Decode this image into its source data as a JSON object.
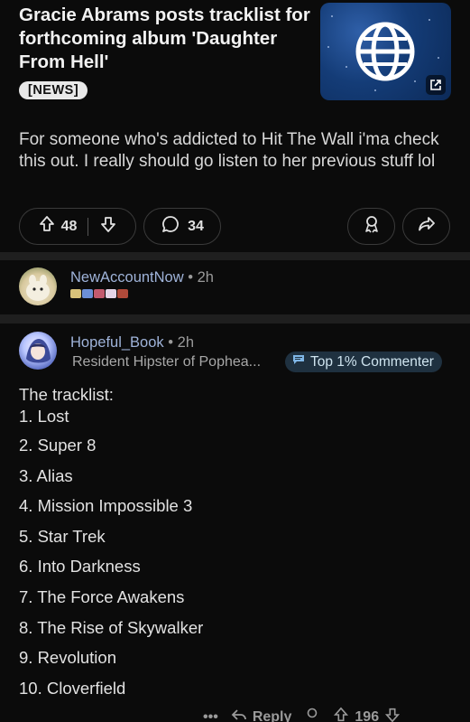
{
  "post": {
    "title": "Gracie Abrams posts tracklist for forthcoming album 'Daughter From Hell'",
    "flair": "[NEWS]",
    "body": "For someone who's addicted to Hit The Wall i'ma check this out. I really should go listen to her previous stuff lol",
    "upvotes": "48",
    "comments": "34",
    "thumbnail_icon": "globe-icon"
  },
  "comments": [
    {
      "username": "NewAccountNow",
      "time": "2h"
    },
    {
      "username": "Hopeful_Book",
      "time": "2h",
      "user_flair": "Resident Hipster of Pophea...",
      "badge": "Top 1% Commenter",
      "intro": "The tracklist:",
      "tracks": [
        "1. Lost",
        "2. Super 8",
        "3. Alias",
        "4. Mission Impossible 3",
        "5. Star Trek",
        "6. Into Darkness",
        "7. The Force Awakens",
        "8. The Rise of Skywalker",
        "9. Revolution",
        "10.  Cloverfield"
      ],
      "more_label": "•••",
      "reply_label": "Reply",
      "votes": "196"
    }
  ],
  "colors": {
    "background": "#0b0b0b",
    "divider": "#1f1f1f",
    "username": "#9fb3d9",
    "badge_bg": "#1f3140"
  }
}
